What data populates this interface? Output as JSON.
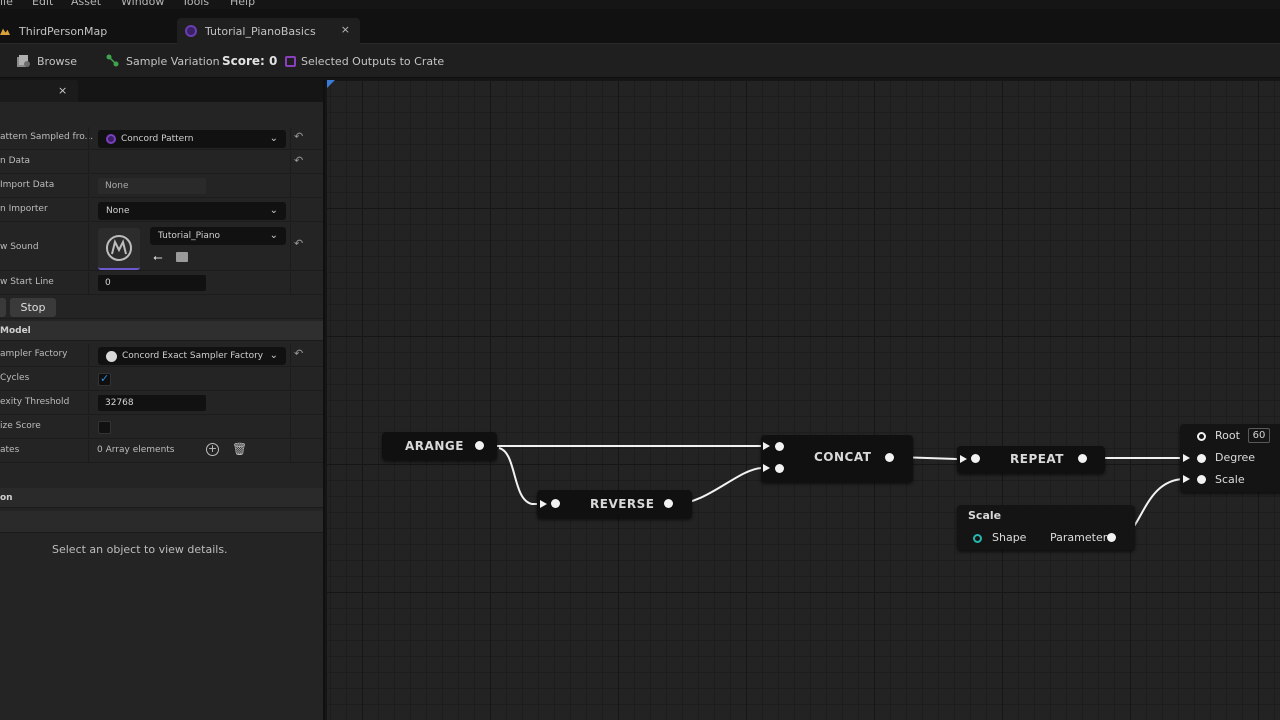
{
  "menu": [
    "ile",
    "Edit",
    "Asset",
    "Window",
    "Tools",
    "Help"
  ],
  "tabs": [
    {
      "label": "ThirdPersonMap"
    },
    {
      "label": "Tutorial_PianoBasics",
      "close": "×"
    }
  ],
  "toolbar": {
    "browse": "Browse",
    "sample_variation": "Sample Variation",
    "score": "Score: 0",
    "selected_outputs": "Selected Outputs to Crate"
  },
  "details": {
    "close": "×",
    "rows": {
      "pattern_sampled_from": {
        "label": "attern Sampled fro...",
        "value": "Concord Pattern"
      },
      "data": {
        "label": "n Data"
      },
      "import_data": {
        "label": "Import Data",
        "value": "None"
      },
      "importer": {
        "label": "n Importer",
        "value": "None"
      },
      "sound": {
        "label": "w Sound",
        "value": "Tutorial_Piano"
      },
      "start_line": {
        "label": "w Start Line",
        "value": "0"
      },
      "stop": "Stop",
      "model_section": "Model",
      "sampler_factory": {
        "label": "ampler Factory",
        "value": "Concord Exact Sampler Factory"
      },
      "cycles": {
        "label": "Cycles"
      },
      "complexity_threshold": {
        "label": "exity Threshold",
        "value": "32768"
      },
      "normalize_score": {
        "label": "ize Score"
      },
      "crates": {
        "label": "ates",
        "value": "0 Array elements"
      },
      "on_section": "on",
      "empty_message": "Select an object to view details."
    }
  },
  "graph": {
    "nodes": {
      "arange": {
        "title": "ARANGE"
      },
      "reverse": {
        "title": "REVERSE"
      },
      "concat": {
        "title": "CONCAT"
      },
      "repeat": {
        "title": "REPEAT"
      },
      "scale": {
        "title": "Scale",
        "shape": "Shape",
        "parameter": "Parameter"
      },
      "output": {
        "root": "Root",
        "root_value": "60",
        "degree": "Degree",
        "scale": "Scale"
      }
    }
  },
  "colors": {
    "accent_blue": "#2f8dde",
    "teal_pin": "#26b8b0",
    "purple_icon": "#7b3fbf"
  }
}
